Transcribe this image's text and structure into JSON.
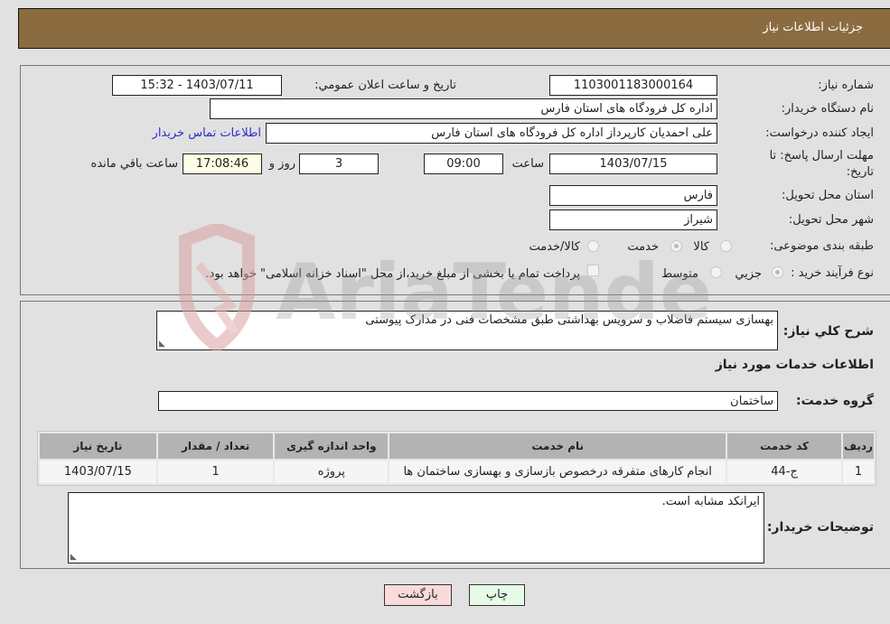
{
  "header": {
    "title": "جزئيات اطلاعات نياز"
  },
  "fields": {
    "need_number": {
      "label": "شماره نياز:",
      "value": "1103001183000164"
    },
    "announce_datetime": {
      "label": "تاريخ و ساعت اعلان عمومي:",
      "value": "1403/07/11 - 15:32"
    },
    "buyer_org": {
      "label": "نام دستگاه خريدار:",
      "value": "اداره کل فرودگاه های استان فارس"
    },
    "requester": {
      "label": "ايجاد کننده درخواست:",
      "value": "علی  احمدیان کارپرداز اداره کل فرودگاه های استان فارس"
    },
    "buyer_contact_link": "اطلاعات تماس خريدار",
    "deadline": {
      "label_line1": "مهلت ارسال پاسخ: تا",
      "label_line2": "تاريخ:",
      "date": "1403/07/15",
      "time_label": "ساعت",
      "time": "09:00",
      "days": "3",
      "days_label": "روز و",
      "remaining": "17:08:46",
      "remaining_label": "ساعت باقي مانده"
    },
    "delivery_province": {
      "label": "استان محل تحويل:",
      "value": "فارس"
    },
    "delivery_city": {
      "label": "شهر محل تحويل:",
      "value": "شيراز"
    },
    "category": {
      "label": "طبقه بندی موضوعی:",
      "options": [
        "کالا",
        "خدمت",
        "کالا/خدمت"
      ],
      "selected": "خدمت"
    },
    "purchase_type": {
      "label": "نوع فرآيند خريد :",
      "options": [
        "جزيي",
        "متوسط"
      ],
      "selected": "جزيي",
      "treasury_note": "پرداخت تمام يا بخشی از مبلغ خريد،از محل \"اسناد خزانه اسلامی\" خواهد بود.",
      "treasury_checked": false
    }
  },
  "description": {
    "label": "شرح كلي نياز:",
    "value": "بهسازی سیستم فاضلاب و سرویس بهداشتی طبق مشخصات فنی در مدارک پیوستی"
  },
  "services_section": {
    "title": "اطلاعات خدمات مورد نياز"
  },
  "service_group": {
    "label": "گروه خدمت:",
    "value": "ساختمان"
  },
  "table": {
    "columns": [
      "رديف",
      "کد خدمت",
      "نام خدمت",
      "واحد اندازه گيری",
      "تعداد / مقدار",
      "تاريخ نياز"
    ],
    "rows": [
      [
        "1",
        "ج-44",
        "انجام کارهای متفرقه درخصوص بازسازی و بهسازی ساختمان ها",
        "پروژه",
        "1",
        "1403/07/15"
      ]
    ]
  },
  "buyer_notes": {
    "label": "توضيحات خريدار:",
    "value": "ایرانکد مشابه است."
  },
  "buttons": {
    "print": "چاپ",
    "back": "بازگشت"
  },
  "watermark": {
    "text": "AriaTender.neT"
  }
}
